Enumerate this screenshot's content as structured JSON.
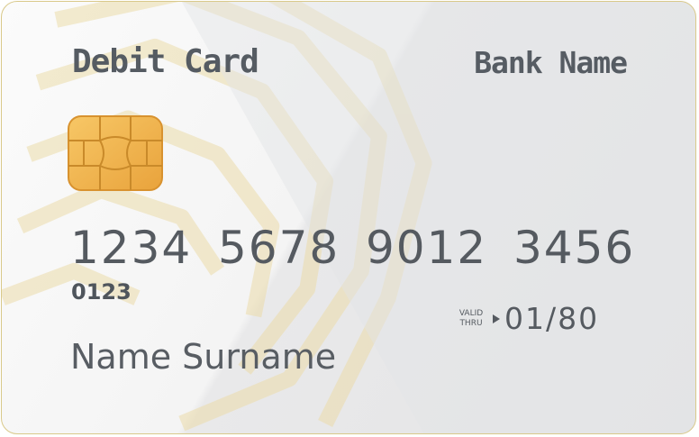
{
  "card": {
    "title": "Debit Card",
    "bank_name": "Bank Name",
    "number_groups": [
      "1234",
      "5678",
      "9012",
      "3456"
    ],
    "small_number": "0123",
    "valid_label_line1": "VALID",
    "valid_label_line2": "THRU",
    "expiry": "01/80",
    "holder_name": "Name Surname"
  },
  "colors": {
    "text": "#555a60",
    "chip": "#f0b547",
    "pattern": "#ecdcaa"
  }
}
